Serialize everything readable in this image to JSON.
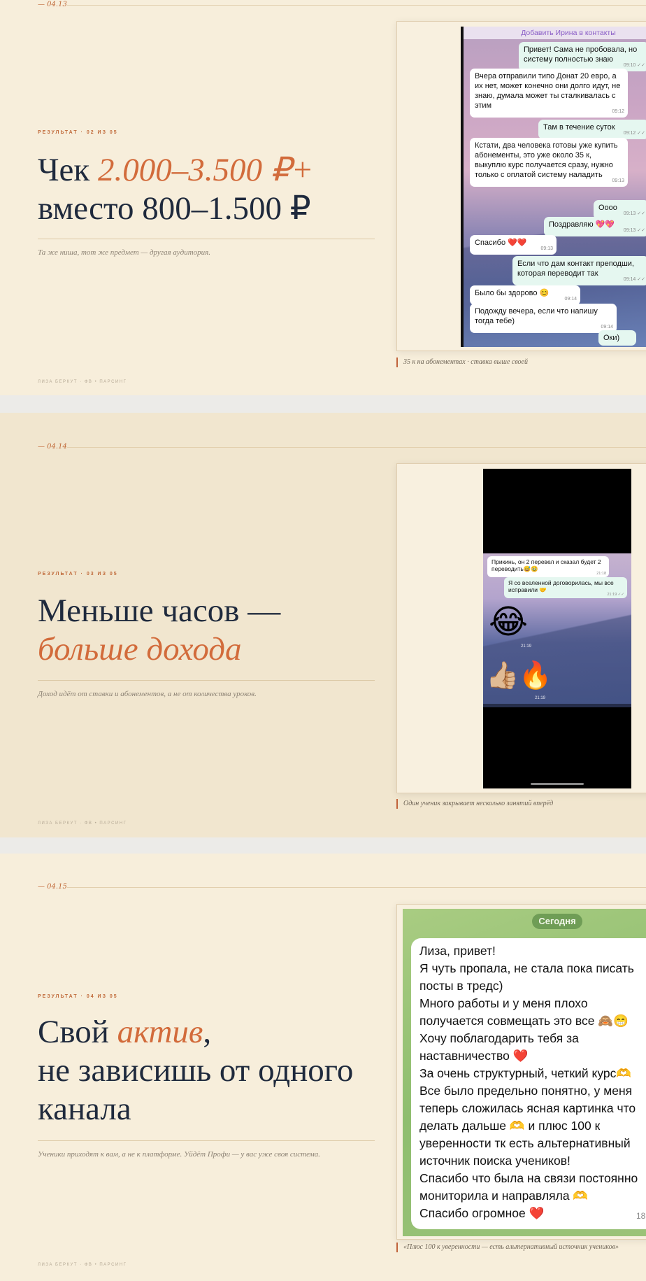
{
  "slides": [
    {
      "num": "— 04.13",
      "eyebrow": "РЕЗУЛЬТАТ · 02 ИЗ 05",
      "headline": {
        "a": "Чек ",
        "b": "2.000–3.500 ₽+",
        "c": "вместо 800–1.500 ₽"
      },
      "sub": "Та же ниша, тот же предмет — другая аудитория.",
      "footer": "ЛИЗА БЕРКУТ · ФВ • ПАРСИНГ",
      "caption": "35 к на абонементах · ставка выше своей"
    },
    {
      "num": "— 04.14",
      "eyebrow": "РЕЗУЛЬТАТ · 03 ИЗ 05",
      "headline": {
        "a": "Меньше часов —",
        "b": "больше дохода"
      },
      "sub": "Доход идёт от ставки и абонементов, а не от количества уроков.",
      "footer": "ЛИЗА БЕРКУТ · ФВ • ПАРСИНГ",
      "caption": "Один ученик закрывает несколько занятий вперёд"
    },
    {
      "num": "— 04.15",
      "eyebrow": "РЕЗУЛЬТАТ · 04 ИЗ 05",
      "headline": {
        "a": "Свой ",
        "b": "актив",
        "c": ",",
        "d": "не зависишь от одного",
        "e": "канала"
      },
      "sub": "Ученики приходят к вам, а не к платформе. Уйдёт Профи — у вас уже своя система.",
      "footer": "ЛИЗА БЕРКУТ · ФВ • ПАРСИНГ",
      "caption": "«Плюс 100 к уверенности — есть альтернативный источник учеников»"
    }
  ],
  "chat1": {
    "banner": "Добавить Ирина в контакты",
    "messages": [
      {
        "dir": "out",
        "text": "Привет! Сама не пробовала, но систему полностью знаю",
        "time": "09:10 ✓✓"
      },
      {
        "dir": "in",
        "text": "Вчера отправили типо Донат 20 евро, а их нет, может конечно они долго идут, не знаю, думала может ты сталкивалась с этим",
        "time": "09:12"
      },
      {
        "dir": "out",
        "text": "Там в течение суток",
        "time": "09:12 ✓✓"
      },
      {
        "dir": "in",
        "text": "Кстати, два человека готовы уже купить абонементы, это уже около 35 к, выкуплю курс получается сразу, нужно только с оплатой систему наладить",
        "time": "09:13"
      },
      {
        "dir": "out",
        "text": "Оооо",
        "time": "09:13 ✓✓"
      },
      {
        "dir": "out",
        "text": "Поздравляю 💖💖",
        "time": "09:13 ✓✓"
      },
      {
        "dir": "in",
        "text": "Спасибо ❤️❤️",
        "time": "09:13"
      },
      {
        "dir": "out",
        "text": "Если что дам контакт преподши, которая переводит так",
        "time": "09:14 ✓✓"
      },
      {
        "dir": "in",
        "text": "Было бы здорово 😊",
        "time": "09:14"
      },
      {
        "dir": "in",
        "text": "Подожду вечера, если что напишу тогда тебе)",
        "time": "09:14"
      },
      {
        "dir": "out",
        "text": "Оки)",
        "time": ""
      }
    ]
  },
  "chat2": {
    "messages": [
      {
        "dir": "in",
        "text": "Прикинь, он 2 перевел и сказал будет 2 переводить😅🥹",
        "time": "21:18"
      },
      {
        "dir": "out",
        "text": "Я со вселенной договорилась, мы все исправили 🤝",
        "time": "21:19 ✓✓"
      }
    ],
    "emoji1": "😂",
    "emoji1_time": "21:19",
    "emoji2": "👍🏼🔥",
    "emoji2_time": "21:19"
  },
  "chat3": {
    "today": "Сегодня",
    "lines": [
      "Лиза, привет!",
      "Я чуть пропала, не стала пока писать",
      "посты в тредс)",
      "Много работы и у меня плохо",
      "получается совмещать это все 🙈😁",
      "Хочу поблагодарить тебя за",
      "наставничество ❤️",
      "За очень структурный, четкий курс🫶",
      "Все было предельно понятно, у меня",
      "теперь сложилась ясная картинка что",
      "делать дальше 🫶 и плюс 100 к",
      "уверенности тк есть альтернативный",
      "источник поиска учеников!",
      "Спасибо что была на связи постоянно",
      "мониторила и направляла 🫶",
      "Спасибо огромное ❤️"
    ],
    "time": "18:"
  }
}
